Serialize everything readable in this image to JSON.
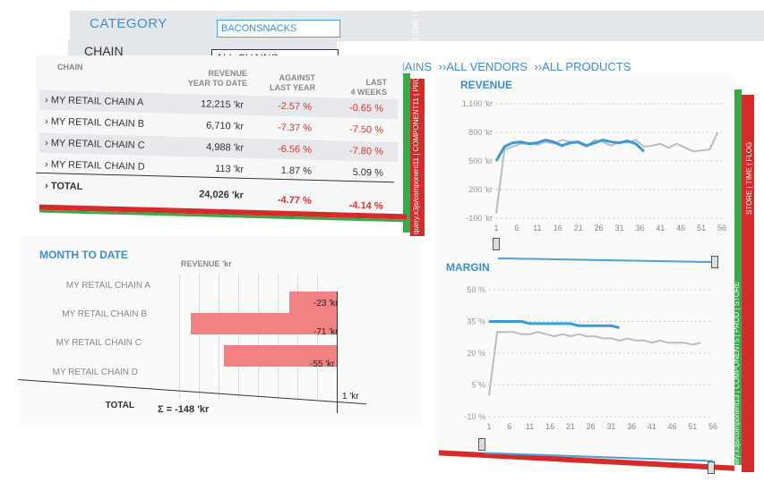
{
  "header": {
    "category_label": "CATEGORY",
    "category_value": "BACONSNACKS",
    "chain_label": "CHAIN",
    "chain_value": "ALL CHAINS",
    "links": [
      "››ALL CHAINS",
      "››ALL VENDORS",
      "››ALL PRODUCTS"
    ]
  },
  "table": {
    "headers": {
      "chain": "CHAIN",
      "revenue": "REVENUE\nYEAR TO DATE",
      "against": "AGAINST\nLAST YEAR",
      "last4": "LAST\n4 WEEKS"
    },
    "rows": [
      {
        "name": "› MY RETAIL CHAIN A",
        "revenue": "12,215 'kr",
        "against": "-2.57 %",
        "last4": "-0.65 %"
      },
      {
        "name": "› MY RETAIL CHAIN B",
        "revenue": "6,710 'kr",
        "against": "-7.37 %",
        "last4": "-7.50 %"
      },
      {
        "name": "› MY RETAIL CHAIN C",
        "revenue": "4,988 'kr",
        "against": "-6.56 %",
        "last4": "-7.80 %"
      },
      {
        "name": "› MY RETAIL CHAIN D",
        "revenue": "113 'kr",
        "against": "1.87 %",
        "last4": "5.09 %"
      }
    ],
    "total": {
      "name": "› TOTAL",
      "revenue": "24,026 'kr",
      "against": "-4.77 %",
      "last4": "-4.14 %"
    },
    "side_labels": [
      "FLOG",
      "STORE",
      "TIME",
      "PROD",
      "COMPONENT11",
      "query.x3js/component11"
    ]
  },
  "mtd": {
    "title": "MONTH TO DATE",
    "subtitle": "REVENUE 'kr",
    "rows": [
      {
        "name": "MY RETAIL CHAIN A",
        "value": -23,
        "label": "-23 'kr"
      },
      {
        "name": "MY RETAIL CHAIN B",
        "value": -71,
        "label": "-71 'kr"
      },
      {
        "name": "MY RETAIL CHAIN C",
        "value": -55,
        "label": "-55 'kr"
      },
      {
        "name": "MY RETAIL CHAIN D",
        "value": 1,
        "label": "1 'kr"
      }
    ],
    "total_label": "TOTAL",
    "total_value": "Σ = -148 'kr"
  },
  "revenue_chart": {
    "title": "REVENUE",
    "y_ticks": [
      "1,100 'kr",
      "800 'kr",
      "500 'kr",
      "200 'kr",
      "-100 'kr"
    ],
    "x_ticks": [
      "1",
      "6",
      "11",
      "16",
      "21",
      "26",
      "31",
      "36",
      "41",
      "46",
      "51",
      "56"
    ],
    "side_labels": [
      "FLOG",
      "TIME",
      "STORE"
    ]
  },
  "margin_chart": {
    "title": "MARGIN",
    "y_ticks": [
      "50 %",
      "35 %",
      "20 %",
      "5 %",
      "-10 %"
    ],
    "x_ticks": [
      "1",
      "6",
      "11",
      "16",
      "21",
      "26",
      "31",
      "36",
      "41",
      "46",
      "51",
      "56"
    ],
    "side_labels": [
      "STORE",
      "PROD",
      "COMPONENT5",
      "query.x3js/component13"
    ]
  },
  "chart_data": [
    {
      "type": "line",
      "title": "REVENUE",
      "ylim": [
        -100,
        1100
      ],
      "x": [
        1,
        3,
        5,
        7,
        9,
        11,
        13,
        15,
        17,
        19,
        21,
        23,
        25,
        27,
        29,
        31,
        33,
        35,
        37,
        39,
        41,
        43,
        45,
        47,
        49,
        51,
        53,
        55
      ],
      "series": [
        {
          "values": [
            -50,
            620,
            650,
            680,
            690,
            670,
            700,
            680,
            720,
            700,
            690,
            650,
            720,
            700,
            660,
            700,
            690,
            720,
            650,
            660,
            680,
            640,
            680,
            640,
            600,
            610,
            620,
            800
          ],
          "color": "#bbbbbb"
        },
        {
          "values": [
            500,
            650,
            690,
            700,
            680,
            690,
            720,
            700,
            660,
            690,
            700,
            660,
            690,
            720,
            700,
            690,
            710,
            680,
            600,
            null,
            null,
            null,
            null,
            null,
            null,
            null,
            null,
            null
          ],
          "color": "#3a9ad9"
        }
      ]
    },
    {
      "type": "line",
      "title": "MARGIN",
      "ylim": [
        -10,
        50
      ],
      "x": [
        1,
        3,
        5,
        7,
        9,
        11,
        13,
        15,
        17,
        19,
        21,
        23,
        25,
        27,
        29,
        31,
        33,
        35,
        37,
        39,
        41,
        43,
        45,
        47,
        49,
        51,
        53
      ],
      "series": [
        {
          "values": [
            0,
            30,
            30,
            30,
            29,
            29,
            30,
            29,
            28,
            29,
            28,
            29,
            28,
            28,
            27,
            27,
            26,
            27,
            26,
            26,
            25,
            26,
            25,
            25,
            25,
            24,
            25
          ],
          "color": "#bbbbbb"
        },
        {
          "values": [
            35,
            35,
            35,
            35,
            35,
            34,
            34,
            34,
            34,
            34,
            34,
            33,
            33,
            33,
            33,
            33,
            32,
            null,
            null,
            null,
            null,
            null,
            null,
            null,
            null,
            null,
            null
          ],
          "color": "#3a9ad9"
        }
      ]
    }
  ]
}
